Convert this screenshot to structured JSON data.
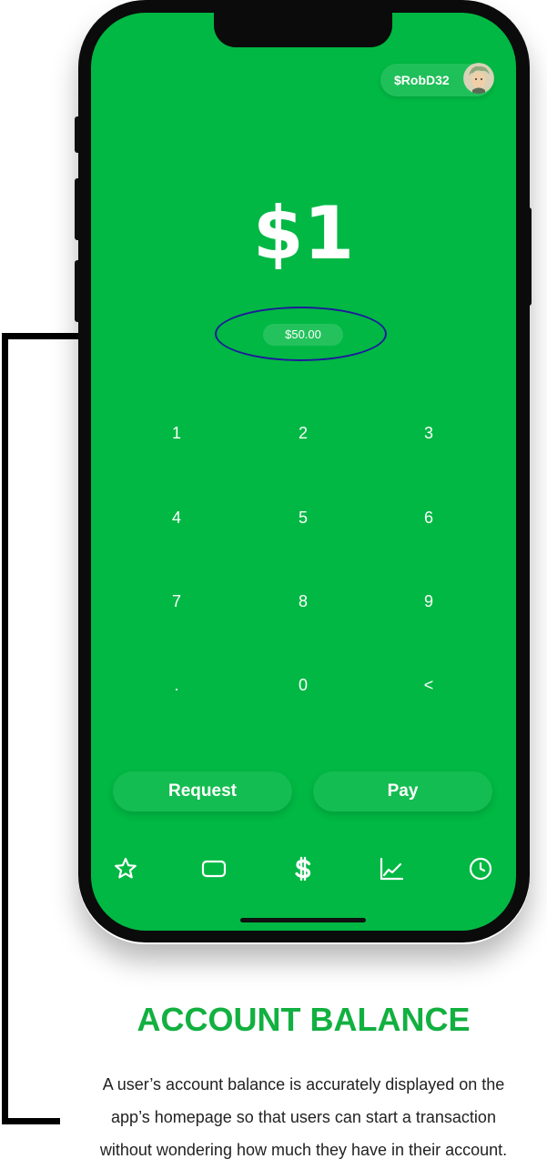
{
  "header": {
    "cashtag": "$RobD32"
  },
  "amount": {
    "value": "$1",
    "balance": "$50.00"
  },
  "keypad": {
    "keys": [
      "1",
      "2",
      "3",
      "4",
      "5",
      "6",
      "7",
      "8",
      "9",
      ".",
      "0",
      "<"
    ]
  },
  "actions": {
    "request_label": "Request",
    "pay_label": "Pay"
  },
  "nav": {
    "icons": [
      "star-icon",
      "card-icon",
      "dollar-icon",
      "chart-icon",
      "clock-icon"
    ]
  },
  "caption": {
    "title": "ACCOUNT BALANCE",
    "lines": [
      "A user’s account balance is accurately displayed on the",
      "app’s homepage so that users can start a transaction",
      "without wondering how much they have in their account."
    ]
  },
  "colors": {
    "brand_green": "#00b843",
    "caption_green": "#12b040",
    "highlight_ellipse": "#1f1a9c"
  }
}
